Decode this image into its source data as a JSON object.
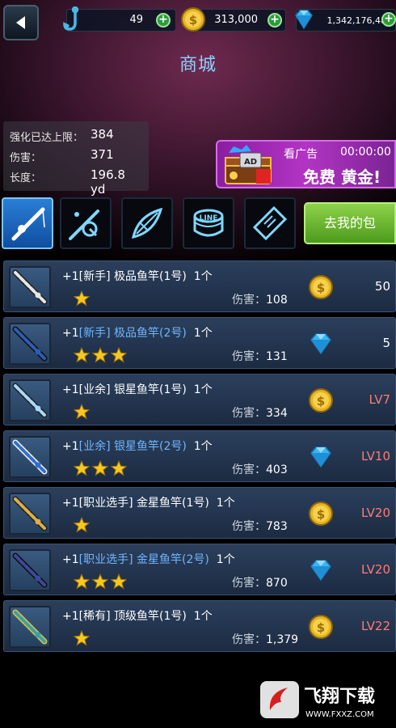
{
  "header": {
    "title": "商城",
    "bait_count": "49",
    "gold_count": "313,000",
    "gem_count": "1,342,176,487"
  },
  "stats": [
    {
      "label": "强化已达上限：",
      "value": "384"
    },
    {
      "label": "伤害：",
      "value": "371"
    },
    {
      "label": "长度：",
      "value": "196.8 yd"
    }
  ],
  "ad": {
    "label": "看广告",
    "timer": "00:00:00",
    "reward": "免费 黄金!",
    "badge": "AD"
  },
  "tabs": [
    {
      "icon": "fishing-rod-icon",
      "active": true
    },
    {
      "icon": "reel-icon",
      "active": false
    },
    {
      "icon": "float-bobber-icon",
      "active": false
    },
    {
      "icon": "line-spool-icon",
      "active": false
    },
    {
      "icon": "ticket-icon",
      "active": false
    }
  ],
  "go_bag_label": "去我的包",
  "damage_label": "伤害：",
  "items": [
    {
      "prefix": "+1",
      "rank": "[新手]",
      "rank_color": "white",
      "name": "极品鱼竿(1号)",
      "qty": "1个",
      "stars": 1,
      "damage": "108",
      "currency": "gold",
      "price": "50",
      "price_type": "amount"
    },
    {
      "prefix": "+1",
      "rank": "[新手]",
      "rank_color": "blue",
      "name": "极品鱼竿(2号)",
      "qty": "1个",
      "stars": 3,
      "damage": "131",
      "currency": "gem",
      "price": "5",
      "price_type": "amount"
    },
    {
      "prefix": "+1",
      "rank": "[业余]",
      "rank_color": "white",
      "name": "银星鱼竿(1号)",
      "qty": "1个",
      "stars": 1,
      "damage": "334",
      "currency": "gold",
      "price": "LV7",
      "price_type": "level"
    },
    {
      "prefix": "+1",
      "rank": "[业余]",
      "rank_color": "blue",
      "name": "银星鱼竿(2号)",
      "qty": "1个",
      "stars": 3,
      "damage": "403",
      "currency": "gem",
      "price": "LV10",
      "price_type": "level"
    },
    {
      "prefix": "+1",
      "rank": "[职业选手]",
      "rank_color": "white",
      "name": "金星鱼竿(1号)",
      "qty": "1个",
      "stars": 1,
      "damage": "783",
      "currency": "gold",
      "price": "LV20",
      "price_type": "level"
    },
    {
      "prefix": "+1",
      "rank": "[职业选手]",
      "rank_color": "blue",
      "name": "金星鱼竿(2号)",
      "qty": "1个",
      "stars": 3,
      "damage": "870",
      "currency": "gem",
      "price": "LV20",
      "price_type": "level"
    },
    {
      "prefix": "+1",
      "rank": "[稀有]",
      "rank_color": "white",
      "name": "顶级鱼竿(1号)",
      "qty": "1个",
      "stars": 1,
      "damage": "1,379",
      "currency": "gold",
      "price": "LV22",
      "price_type": "level"
    }
  ],
  "watermark": {
    "text": "飞翔下载",
    "url": "WWW.FXXZ.COM"
  },
  "colors": {
    "blue_rank": "#6fb6ff",
    "level_price": "#ff7b72",
    "title": "#8fd1ff",
    "go_bag": "#6bb832"
  }
}
